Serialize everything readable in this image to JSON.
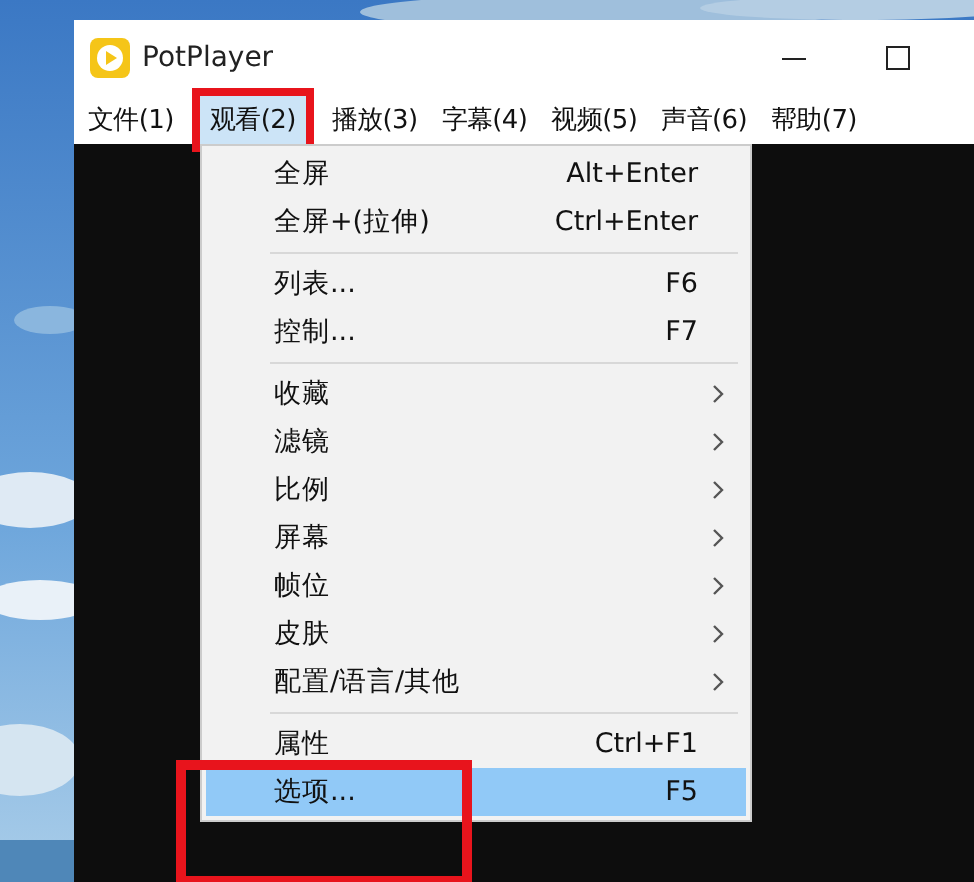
{
  "window": {
    "title": "PotPlayer"
  },
  "menubar": [
    {
      "label": "文件(1)",
      "selected": false,
      "annotated": false
    },
    {
      "label": "观看(2)",
      "selected": true,
      "annotated": true
    },
    {
      "label": "播放(3)",
      "selected": false,
      "annotated": false
    },
    {
      "label": "字幕(4)",
      "selected": false,
      "annotated": false
    },
    {
      "label": "视频(5)",
      "selected": false,
      "annotated": false
    },
    {
      "label": "声音(6)",
      "selected": false,
      "annotated": false
    },
    {
      "label": "帮助(7)",
      "selected": false,
      "annotated": false
    }
  ],
  "menu": {
    "sections": [
      [
        {
          "label": "全屏",
          "shortcut": "Alt+Enter",
          "submenu": false,
          "selected": false,
          "annotated": false
        },
        {
          "label": "全屏+(拉伸)",
          "shortcut": "Ctrl+Enter",
          "submenu": false,
          "selected": false,
          "annotated": false
        }
      ],
      [
        {
          "label": "列表...",
          "shortcut": "F6",
          "submenu": false,
          "selected": false,
          "annotated": false
        },
        {
          "label": "控制...",
          "shortcut": "F7",
          "submenu": false,
          "selected": false,
          "annotated": false
        }
      ],
      [
        {
          "label": "收藏",
          "submenu": true,
          "selected": false,
          "annotated": false
        },
        {
          "label": "滤镜",
          "submenu": true,
          "selected": false,
          "annotated": false
        },
        {
          "label": "比例",
          "submenu": true,
          "selected": false,
          "annotated": false
        },
        {
          "label": "屏幕",
          "submenu": true,
          "selected": false,
          "annotated": false
        },
        {
          "label": "帧位",
          "submenu": true,
          "selected": false,
          "annotated": false
        },
        {
          "label": "皮肤",
          "submenu": true,
          "selected": false,
          "annotated": false
        },
        {
          "label": "配置/语言/其他",
          "submenu": true,
          "selected": false,
          "annotated": false
        }
      ],
      [
        {
          "label": "属性",
          "shortcut": "Ctrl+F1",
          "submenu": false,
          "selected": false,
          "annotated": false
        },
        {
          "label": "选项...",
          "shortcut": "F5",
          "submenu": false,
          "selected": true,
          "annotated": true
        }
      ]
    ]
  }
}
